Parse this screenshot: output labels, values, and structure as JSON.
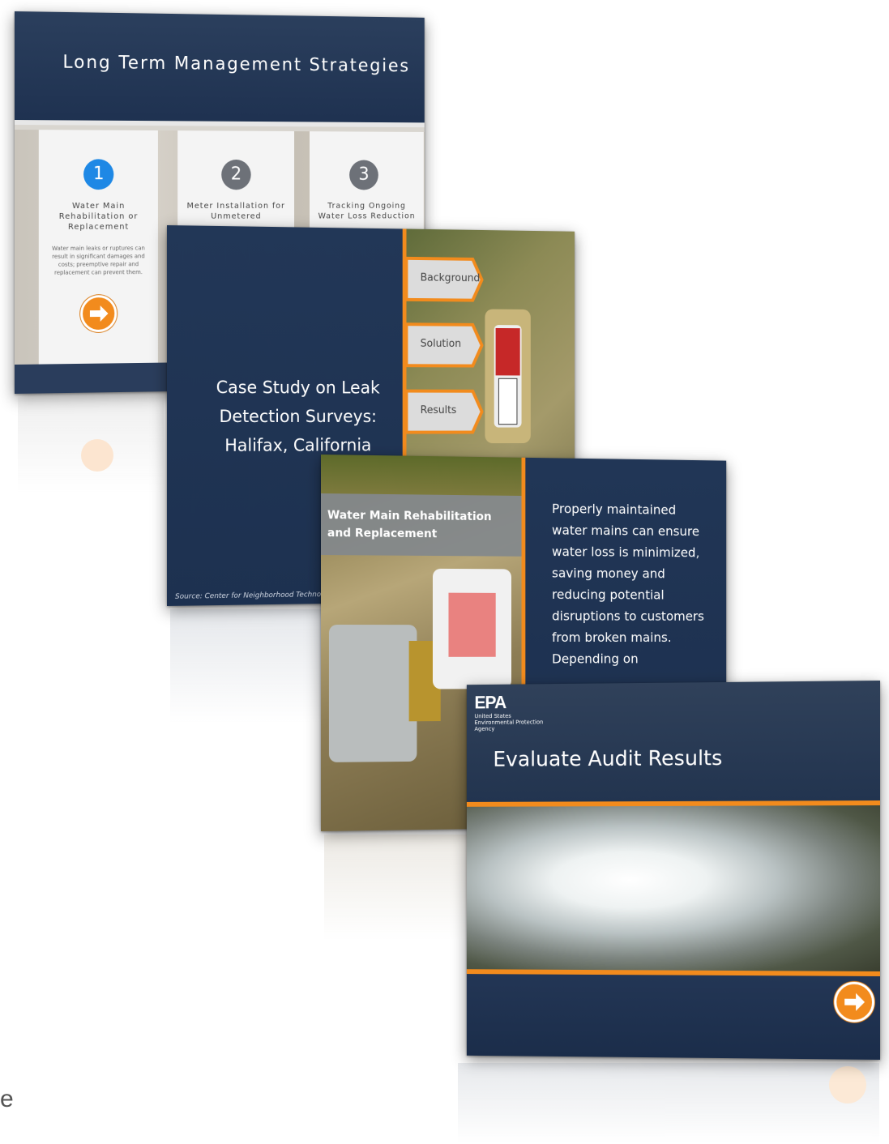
{
  "slide1": {
    "title": "Long Term Management Strategies",
    "columns": [
      {
        "num": "1",
        "title": "Water Main Rehabilitation or Replacement",
        "text": "Water main leaks or ruptures can result in significant damages and costs; preemptive repair and replacement can prevent them."
      },
      {
        "num": "2",
        "title": "Meter Installation for Unmetered"
      },
      {
        "num": "3",
        "title": "Tracking Ongoing Water Loss Reduction"
      }
    ]
  },
  "slide2": {
    "title_lines": [
      "Case Study on Leak",
      "Detection Surveys:",
      "Halifax, California"
    ],
    "tabs": [
      "Background",
      "Solution",
      "Results"
    ],
    "source": "Source: Center for Neighborhood Techno"
  },
  "slide3": {
    "heading": "Water Main Rehabilitation and Replacement",
    "body": "Properly maintained water mains can ensure water loss is minimized, saving money and reducing potential disruptions to customers from broken mains. Depending on"
  },
  "slide4": {
    "logo": "EPA",
    "agency_lines": [
      "United States",
      "Environmental Protection",
      "Agency"
    ],
    "title": "Evaluate Audit Results"
  },
  "edge_text": "e",
  "colors": {
    "navy": "#1f3454",
    "orange": "#f28b1d",
    "blue_active": "#1e88e5",
    "gray_inactive": "#6d7178"
  }
}
